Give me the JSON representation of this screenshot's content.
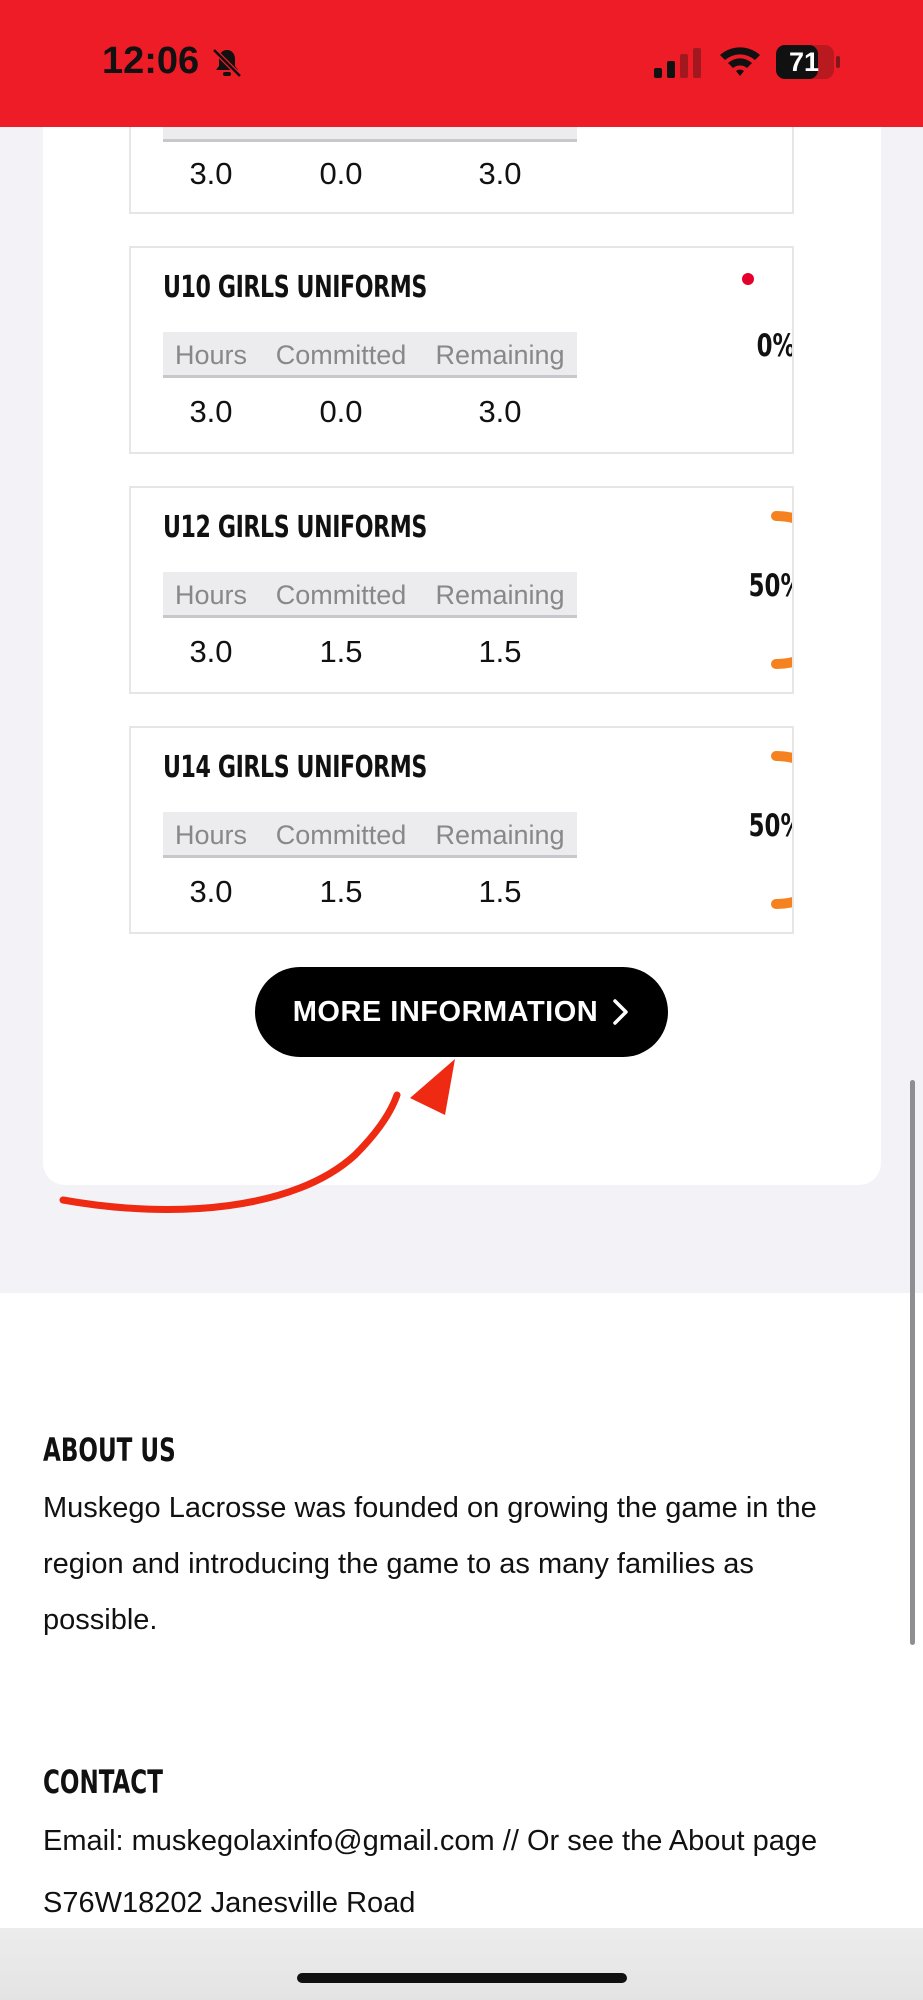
{
  "status_bar": {
    "time": "12:06",
    "battery": "71"
  },
  "stat_headers": {
    "hours": "Hours",
    "committed": "Committed",
    "remaining": "Remaining"
  },
  "needs": [
    {
      "title": "",
      "hours": "3.0",
      "committed": "0.0",
      "remaining": "3.0"
    },
    {
      "title": "U10 GIRLS UNIFORMS",
      "hours": "3.0",
      "committed": "0.0",
      "remaining": "3.0",
      "progress_label": "0%",
      "progress": 0
    },
    {
      "title": "U12 GIRLS UNIFORMS",
      "hours": "3.0",
      "committed": "1.5",
      "remaining": "1.5",
      "progress_label": "50%",
      "progress": 0.5
    },
    {
      "title": "U14 GIRLS UNIFORMS",
      "hours": "3.0",
      "committed": "1.5",
      "remaining": "1.5",
      "progress_label": "50%",
      "progress": 0.5
    }
  ],
  "more_button": {
    "label": "MORE INFORMATION"
  },
  "footer": {
    "about_heading": "ABOUT US",
    "about_text": "Muskego Lacrosse was founded on growing the game in the region and introducing the game to as many families as possible.",
    "contact_heading": "CONTACT",
    "contact_email": "Email: muskegolaxinfo@gmail.com // Or see the About page",
    "address_partial": "S76W18202 Janesville Road"
  },
  "colors": {
    "status_bar": "#ee1c27",
    "progress": "#f5811f",
    "annotation_arrow": "#ee2a12",
    "dot": "#e4002b"
  }
}
